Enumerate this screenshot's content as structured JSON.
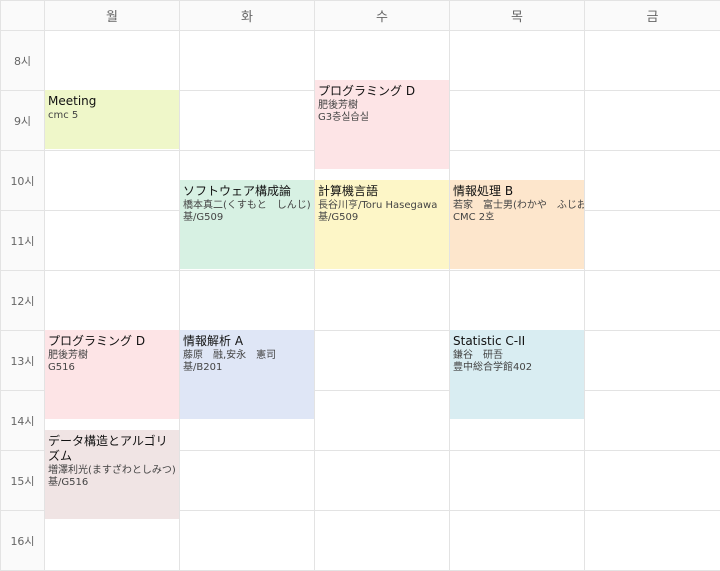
{
  "days": [
    "월",
    "화",
    "수",
    "목",
    "금"
  ],
  "hours": [
    "8시",
    "9시",
    "10시",
    "11시",
    "12시",
    "13시",
    "14시",
    "15시",
    "16시"
  ],
  "events": [
    {
      "title": "Meeting",
      "lines": [
        "cmc 5"
      ],
      "color": "#eff7c9"
    },
    {
      "title": "プログラミング D",
      "lines": [
        "肥後芳樹",
        "G3층실습실"
      ],
      "color": "#fde4e6"
    },
    {
      "title": "ソフトウェア構成論",
      "lines": [
        "橋本真二(くすもと　しんじ)",
        "基/G509"
      ],
      "color": "#d7f1e3"
    },
    {
      "title": "計算機言語",
      "lines": [
        "長谷川亨/Toru Hasegawa",
        "基/G509"
      ],
      "color": "#fdf6c7"
    },
    {
      "title": "情報処理 B",
      "lines": [
        "若家　富士男(わかや　ふじお",
        "CMC 2호"
      ],
      "color": "#fde6cc"
    },
    {
      "title": "プログラミング D",
      "lines": [
        "肥後芳樹",
        "G516"
      ],
      "color": "#fde4e6"
    },
    {
      "title": "情報解析 A",
      "lines": [
        "藤原　融,安永　憲司",
        "基/B201"
      ],
      "color": "#dfe6f6"
    },
    {
      "title": "Statistic C-II",
      "lines": [
        "鎌谷　研吾",
        "豊中総合学館402"
      ],
      "color": "#d9edf2"
    },
    {
      "title": "データ構造とアルゴリズム",
      "lines": [
        "増澤利光(ますざわとしみつ)",
        "基/G516"
      ],
      "color": "#f0e4e4"
    }
  ]
}
